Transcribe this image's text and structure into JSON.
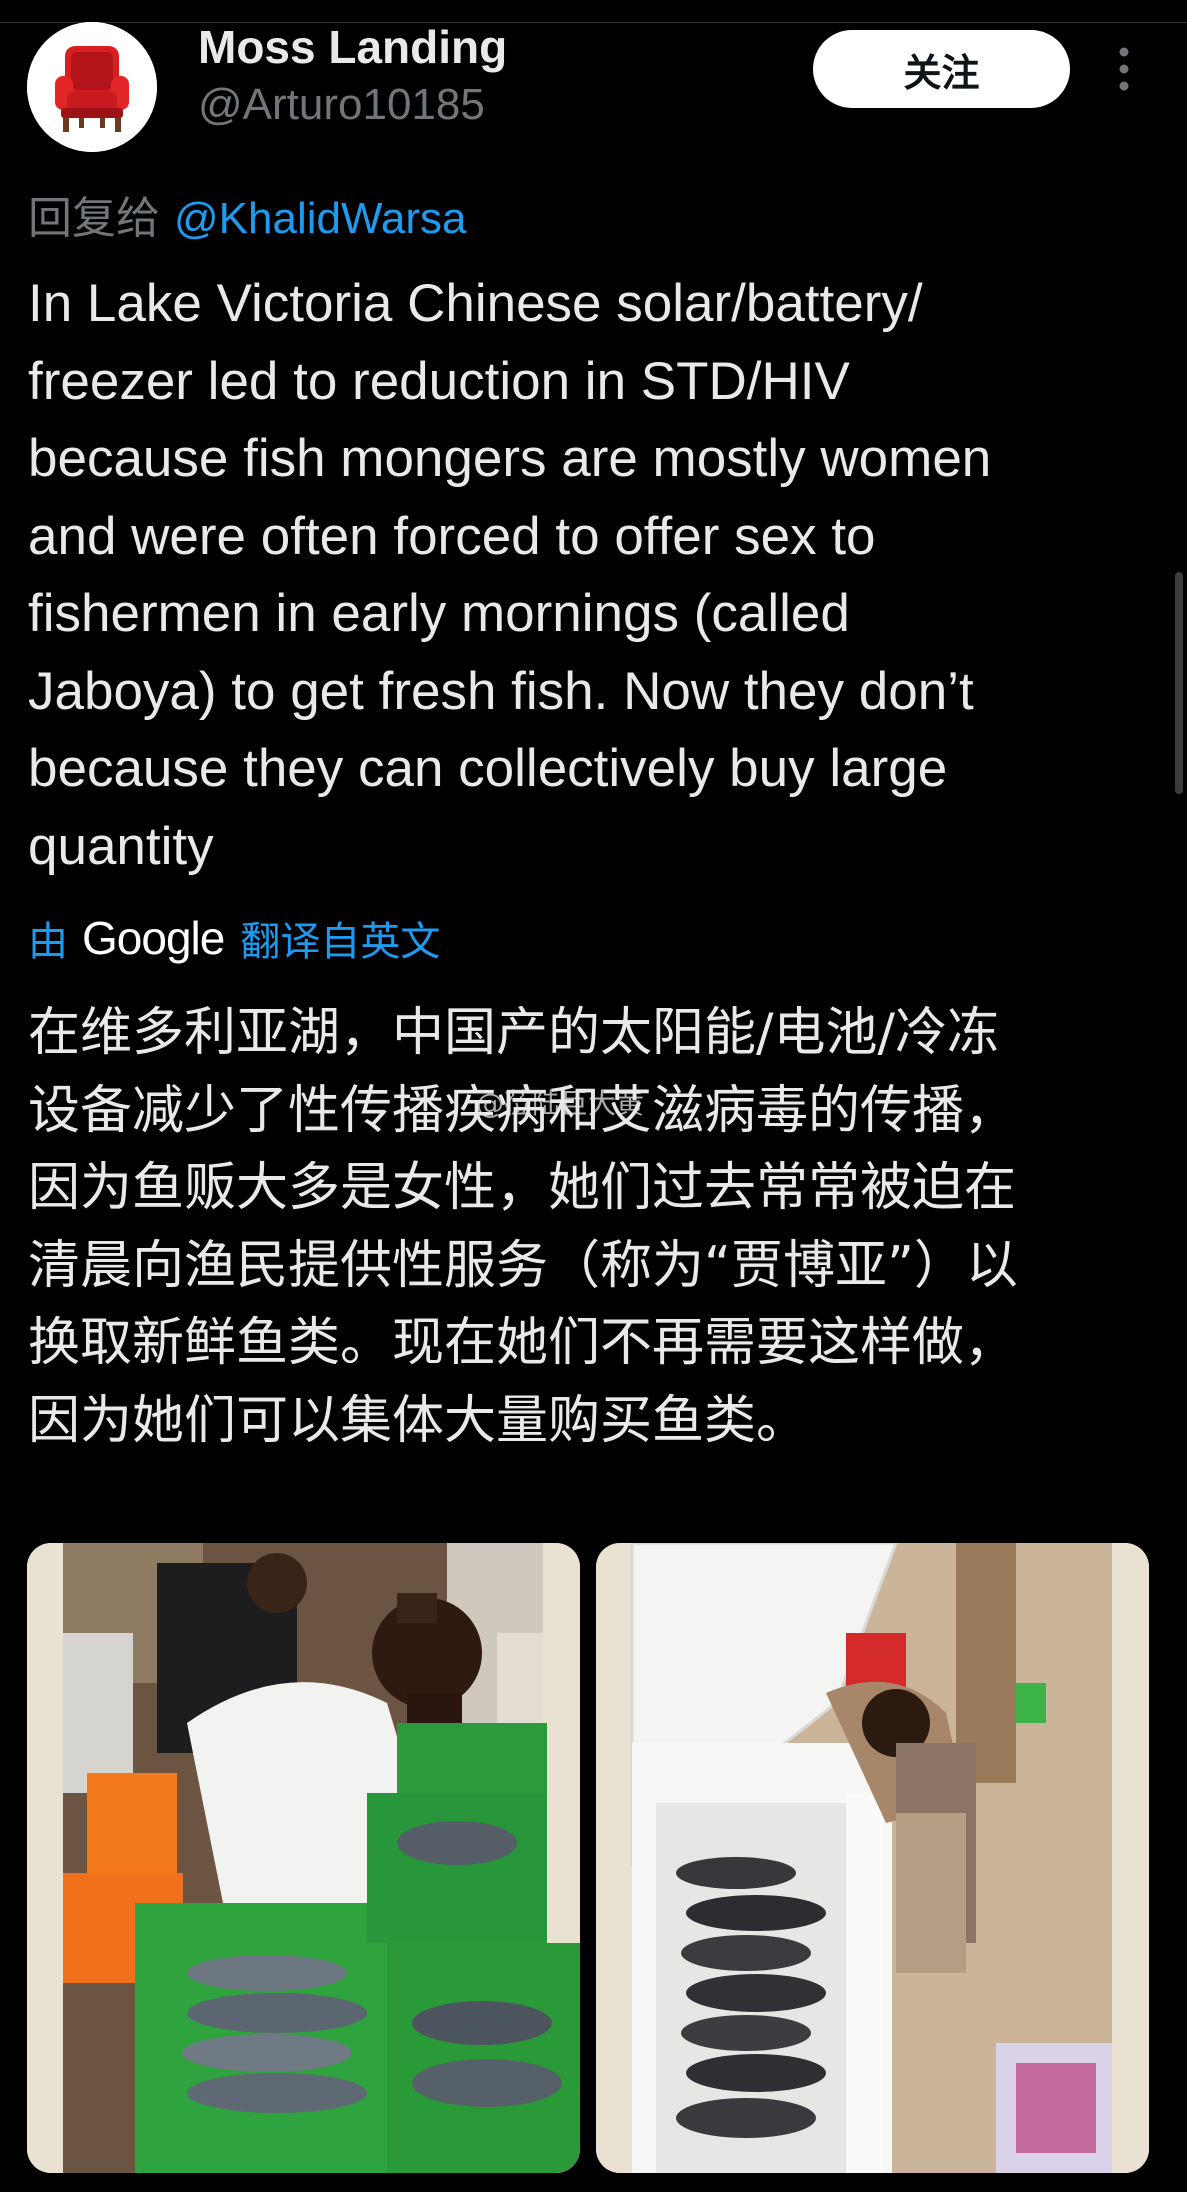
{
  "author": {
    "display_name": "Moss Landing",
    "handle": "@Arturo10185",
    "avatar_icon": "red-armchair-icon"
  },
  "header": {
    "follow_label": "关注",
    "more_icon": "more-vertical-icon"
  },
  "reply": {
    "prefix": "回复给",
    "mention": "@KhalidWarsa"
  },
  "tweet": {
    "lines": [
      "In Lake Victoria Chinese solar/battery/",
      "freezer led to reduction in STD/HIV",
      "because fish mongers are mostly women",
      "and were often forced to offer sex to",
      "fishermen in early mornings (called",
      "Jaboya) to get fresh fish. Now they don’t",
      "because they can collectively buy large",
      "quantity"
    ]
  },
  "translation_bar": {
    "by": "由",
    "provider": "Google",
    "translated_from": "翻译自英文"
  },
  "translation": {
    "lines": [
      "在维多利亚湖，中国产的太阳能/电池/冷冻",
      "设备减少了性传播疾病和艾滋病毒的传播，",
      "因为鱼贩大多是女性，她们过去常常被迫在",
      "清晨向渔民提供性服务（称为“贾博亚”）以",
      "换取新鲜鱼类。现在她们不再需要这样做，",
      "因为她们可以集体大量购买鱼类。"
    ]
  },
  "watermark": "@莅陆巨大黄",
  "media": [
    {
      "icon": "photo-fish-crates"
    },
    {
      "icon": "photo-chest-freezer"
    }
  ],
  "colors": {
    "background": "#000000",
    "text_primary": "#e7e9ea",
    "text_secondary": "#71767b",
    "link_blue": "#1d9bf0",
    "follow_button_bg": "#ffffff"
  }
}
